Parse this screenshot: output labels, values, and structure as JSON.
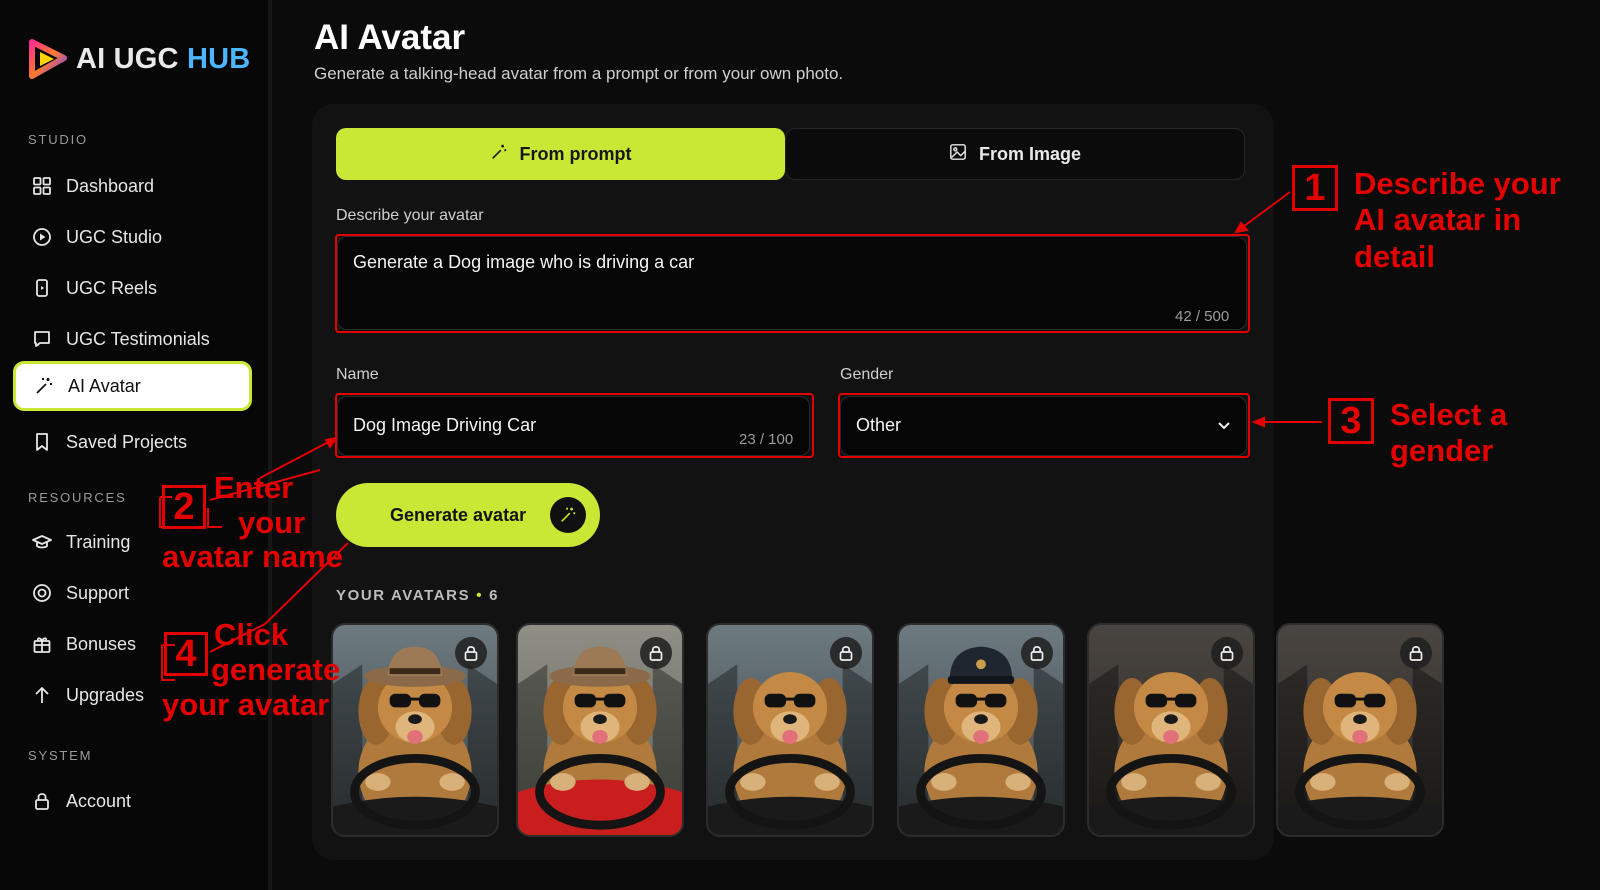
{
  "brand": {
    "logo_prefix": "AI UGC",
    "logo_suffix": "HUB"
  },
  "sidebar": {
    "sections": {
      "studio": "STUDIO",
      "resources": "RESOURCES",
      "system": "SYSTEM"
    },
    "items": [
      {
        "label": "Dashboard",
        "icon": "grid-icon"
      },
      {
        "label": "UGC Studio",
        "icon": "play-circle-icon"
      },
      {
        "label": "UGC Reels",
        "icon": "phone-icon"
      },
      {
        "label": "UGC Testimonials",
        "icon": "chat-icon"
      },
      {
        "label": "AI Avatar",
        "icon": "magic-wand-icon",
        "active": true
      },
      {
        "label": "Saved Projects",
        "icon": "bookmark-icon"
      },
      {
        "label": "Training",
        "icon": "graduation-cap-icon"
      },
      {
        "label": "Support",
        "icon": "support-icon"
      },
      {
        "label": "Bonuses",
        "icon": "gift-icon"
      },
      {
        "label": "Upgrades",
        "icon": "arrow-up-icon"
      },
      {
        "label": "Account",
        "icon": "lock-icon"
      }
    ]
  },
  "header": {
    "title": "AI Avatar",
    "subtitle": "Generate a talking-head avatar from a prompt or from your own photo."
  },
  "tabs": [
    {
      "label": "From prompt",
      "icon": "magic-wand-icon",
      "active": true
    },
    {
      "label": "From Image",
      "icon": "image-icon",
      "active": false
    }
  ],
  "prompt": {
    "label": "Describe your avatar",
    "value": "Generate a Dog image who is driving a car",
    "counter": "42 / 500"
  },
  "name": {
    "label": "Name",
    "value": "Dog Image Driving Car",
    "counter": "23 / 100"
  },
  "gender": {
    "label": "Gender",
    "selected": "Other"
  },
  "generate_button": {
    "label": "Generate avatar"
  },
  "avatars": {
    "title": "YOUR AVATARS",
    "count": "6",
    "items": [
      {
        "hat": "cowboy",
        "car": "dark"
      },
      {
        "hat": "cowboy",
        "car": "red"
      },
      {
        "hat": "none",
        "car": "dark"
      },
      {
        "hat": "captain",
        "car": "dark"
      },
      {
        "hat": "none",
        "car": "interior"
      },
      {
        "hat": "none",
        "car": "interior"
      }
    ]
  },
  "annotations": {
    "step1": {
      "num": "1",
      "line1": "Describe your",
      "line2": "AI avatar in detail"
    },
    "step2": {
      "num": "2",
      "line1": "Enter",
      "line2": "your",
      "line3": "avatar name"
    },
    "step3": {
      "num": "3",
      "line1": "Select a",
      "line2": "gender"
    },
    "step4": {
      "num": "4",
      "line1": "Click",
      "line2": "generate",
      "line3": "your avatar"
    }
  },
  "colors": {
    "accent": "#c8e835",
    "annotation": "#e40000",
    "background": "#0b0b0b",
    "panel": "#121212"
  }
}
